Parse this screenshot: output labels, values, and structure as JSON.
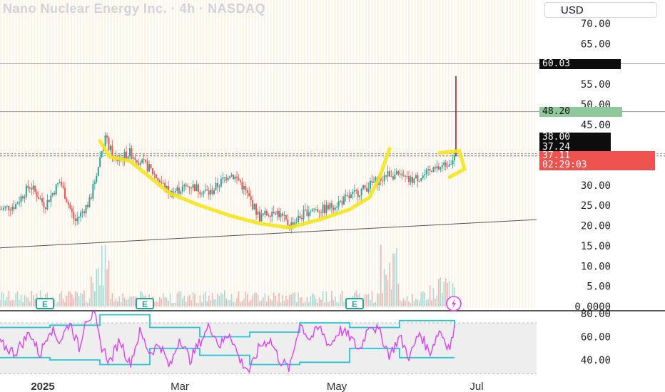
{
  "header": {
    "title": "Nano Nuclear Energy Inc. · 4h · NASDAQ",
    "currency": "USD"
  },
  "colors": {
    "up": "#26a69a",
    "down": "#ef5350",
    "rsi_line": "#e040fb",
    "band": "#26c6da",
    "highlight": "#f5e51b",
    "green_tag": "#8fc99b",
    "red_tag": "#ef5350",
    "dark_tag": "#0d0d0d"
  },
  "chart_data": [
    {
      "type": "candlestick",
      "title": "Nano Nuclear Energy Inc. · 4h · NASDAQ",
      "x_ticks": [
        "2025",
        "Mar",
        "May",
        "Jul"
      ],
      "y_ticks": [
        "70.00",
        "65.00",
        "60.00",
        "55.00",
        "50.00",
        "45.00",
        "40.00",
        "35.00",
        "30.00",
        "25.00",
        "20.00",
        "15.00",
        "10.00",
        "5.00",
        "0.0000"
      ],
      "ylim": [
        0,
        74
      ],
      "price_path": [
        {
          "t": 0.0,
          "p": 24
        },
        {
          "t": 0.03,
          "p": 25
        },
        {
          "t": 0.06,
          "p": 30
        },
        {
          "t": 0.09,
          "p": 25
        },
        {
          "t": 0.12,
          "p": 31
        },
        {
          "t": 0.15,
          "p": 21
        },
        {
          "t": 0.18,
          "p": 26
        },
        {
          "t": 0.21,
          "p": 42
        },
        {
          "t": 0.23,
          "p": 36
        },
        {
          "t": 0.26,
          "p": 38
        },
        {
          "t": 0.3,
          "p": 34
        },
        {
          "t": 0.34,
          "p": 28
        },
        {
          "t": 0.38,
          "p": 30
        },
        {
          "t": 0.42,
          "p": 28
        },
        {
          "t": 0.46,
          "p": 33
        },
        {
          "t": 0.48,
          "p": 31
        },
        {
          "t": 0.52,
          "p": 22
        },
        {
          "t": 0.55,
          "p": 24
        },
        {
          "t": 0.58,
          "p": 20
        },
        {
          "t": 0.62,
          "p": 24
        },
        {
          "t": 0.65,
          "p": 24
        },
        {
          "t": 0.7,
          "p": 27
        },
        {
          "t": 0.74,
          "p": 30
        },
        {
          "t": 0.78,
          "p": 33
        },
        {
          "t": 0.82,
          "p": 31
        },
        {
          "t": 0.86,
          "p": 33
        },
        {
          "t": 0.89,
          "p": 35
        },
        {
          "t": 0.91,
          "p": 37
        }
      ],
      "current_price": 37.11,
      "spike_high": 57,
      "price_tags": [
        {
          "label": "60.03",
          "value": 60.03,
          "kind": "dark"
        },
        {
          "label": "48.20",
          "value": 48.2,
          "kind": "green"
        },
        {
          "label": "38.00",
          "value": 38.0,
          "kind": "dark"
        },
        {
          "label": "37.24",
          "value": 37.24,
          "kind": "dark"
        },
        {
          "label": "37.11",
          "value": 37.11,
          "kind": "red"
        },
        {
          "label": "02:29:03",
          "value": null,
          "kind": "red"
        }
      ],
      "horizontal_lines": [
        60.03,
        48.2,
        37.8,
        37.24
      ],
      "trendline": {
        "start": [
          0.0,
          14.5
        ],
        "end": [
          1.0,
          21.5
        ]
      },
      "earnings_markers": [
        0.09,
        0.29,
        0.71
      ],
      "earnings_label": "E",
      "dividend_marker": 0.86
    },
    {
      "type": "line",
      "y_ticks": [
        "80.00",
        "60.00",
        "40.00"
      ],
      "ylim": [
        25,
        82
      ],
      "rsi": [
        {
          "t": 0.0,
          "v": 54
        },
        {
          "t": 0.03,
          "v": 46
        },
        {
          "t": 0.06,
          "v": 64
        },
        {
          "t": 0.08,
          "v": 44
        },
        {
          "t": 0.1,
          "v": 68
        },
        {
          "t": 0.12,
          "v": 56
        },
        {
          "t": 0.14,
          "v": 73
        },
        {
          "t": 0.16,
          "v": 48
        },
        {
          "t": 0.17,
          "v": 76
        },
        {
          "t": 0.19,
          "v": 78
        },
        {
          "t": 0.2,
          "v": 55
        },
        {
          "t": 0.22,
          "v": 38
        },
        {
          "t": 0.24,
          "v": 58
        },
        {
          "t": 0.26,
          "v": 36
        },
        {
          "t": 0.28,
          "v": 64
        },
        {
          "t": 0.3,
          "v": 46
        },
        {
          "t": 0.32,
          "v": 54
        },
        {
          "t": 0.34,
          "v": 33
        },
        {
          "t": 0.36,
          "v": 60
        },
        {
          "t": 0.38,
          "v": 40
        },
        {
          "t": 0.4,
          "v": 55
        },
        {
          "t": 0.42,
          "v": 70
        },
        {
          "t": 0.44,
          "v": 52
        },
        {
          "t": 0.46,
          "v": 64
        },
        {
          "t": 0.48,
          "v": 40
        },
        {
          "t": 0.5,
          "v": 30
        },
        {
          "t": 0.52,
          "v": 52
        },
        {
          "t": 0.54,
          "v": 58
        },
        {
          "t": 0.56,
          "v": 40
        },
        {
          "t": 0.58,
          "v": 32
        },
        {
          "t": 0.6,
          "v": 72
        },
        {
          "t": 0.62,
          "v": 58
        },
        {
          "t": 0.64,
          "v": 68
        },
        {
          "t": 0.66,
          "v": 52
        },
        {
          "t": 0.68,
          "v": 66
        },
        {
          "t": 0.7,
          "v": 60
        },
        {
          "t": 0.72,
          "v": 48
        },
        {
          "t": 0.74,
          "v": 72
        },
        {
          "t": 0.76,
          "v": 64
        },
        {
          "t": 0.78,
          "v": 44
        },
        {
          "t": 0.8,
          "v": 60
        },
        {
          "t": 0.82,
          "v": 42
        },
        {
          "t": 0.84,
          "v": 64
        },
        {
          "t": 0.86,
          "v": 46
        },
        {
          "t": 0.88,
          "v": 66
        },
        {
          "t": 0.9,
          "v": 50
        },
        {
          "t": 0.91,
          "v": 66
        }
      ],
      "band_upper": [
        {
          "t": 0.0,
          "v": 68
        },
        {
          "t": 0.1,
          "v": 70
        },
        {
          "t": 0.2,
          "v": 79
        },
        {
          "t": 0.3,
          "v": 68
        },
        {
          "t": 0.4,
          "v": 60
        },
        {
          "t": 0.5,
          "v": 64
        },
        {
          "t": 0.6,
          "v": 72
        },
        {
          "t": 0.7,
          "v": 68
        },
        {
          "t": 0.8,
          "v": 74
        },
        {
          "t": 0.91,
          "v": 68
        }
      ],
      "band_lower": [
        {
          "t": 0.0,
          "v": 42
        },
        {
          "t": 0.1,
          "v": 40
        },
        {
          "t": 0.2,
          "v": 36
        },
        {
          "t": 0.3,
          "v": 50
        },
        {
          "t": 0.4,
          "v": 44
        },
        {
          "t": 0.5,
          "v": 36
        },
        {
          "t": 0.6,
          "v": 38
        },
        {
          "t": 0.7,
          "v": 50
        },
        {
          "t": 0.8,
          "v": 42
        },
        {
          "t": 0.91,
          "v": 42
        }
      ]
    }
  ]
}
